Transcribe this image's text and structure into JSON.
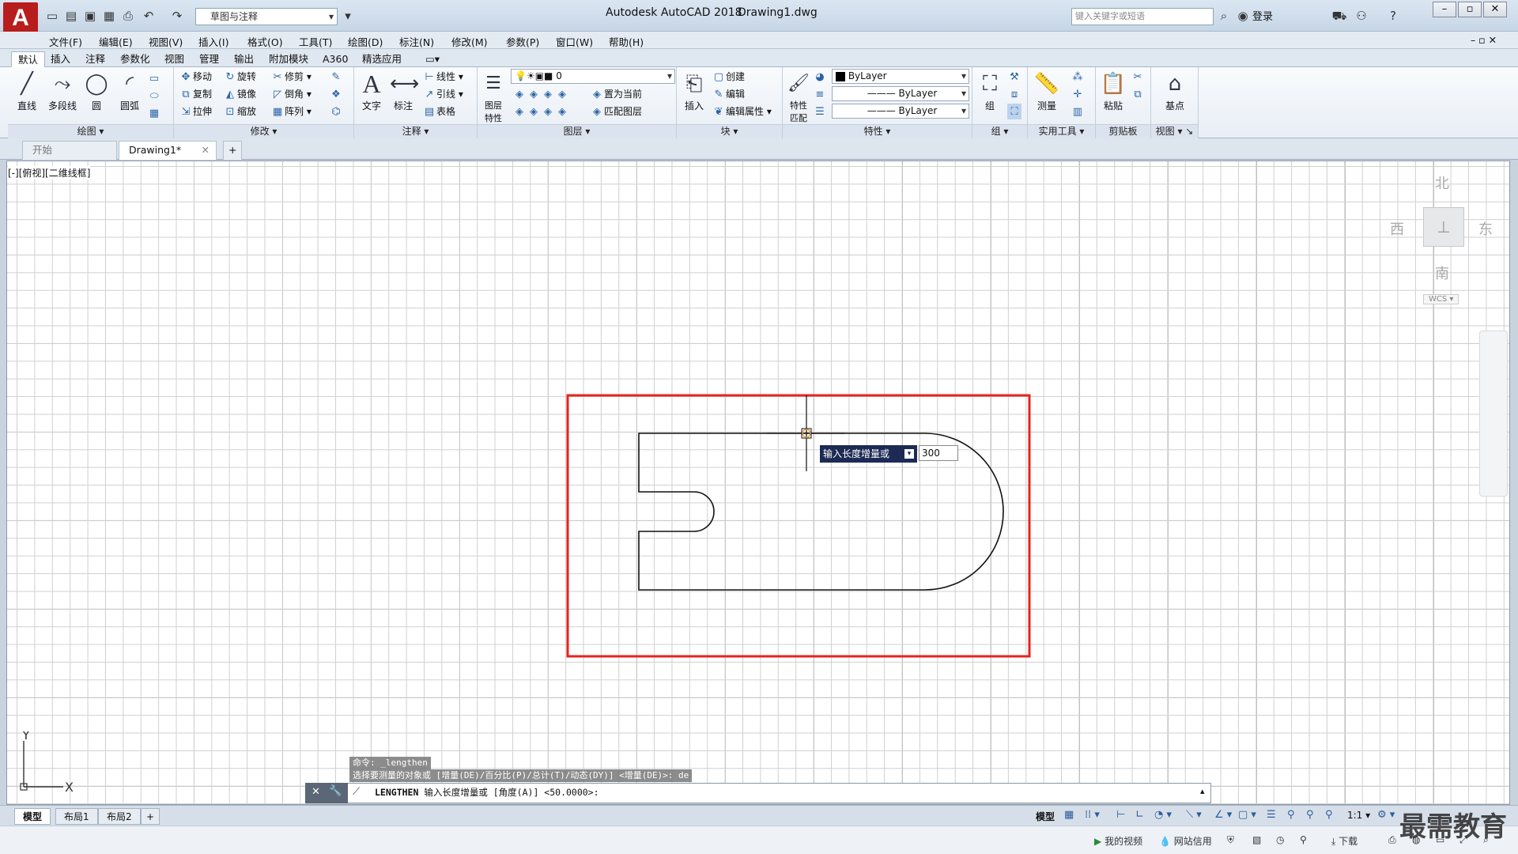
{
  "app": {
    "logo": "A",
    "title": "Autodesk AutoCAD 2018",
    "document": "Drawing1.dwg",
    "workspace": "草图与注释",
    "search_placeholder": "键入关键字或短语",
    "login": "登录"
  },
  "menus": [
    "文件(F)",
    "编辑(E)",
    "视图(V)",
    "插入(I)",
    "格式(O)",
    "工具(T)",
    "绘图(D)",
    "标注(N)",
    "修改(M)",
    "参数(P)",
    "窗口(W)",
    "帮助(H)"
  ],
  "ribbon_tabs": [
    "默认",
    "插入",
    "注释",
    "参数化",
    "视图",
    "管理",
    "输出",
    "附加模块",
    "A360",
    "精选应用"
  ],
  "ribbon": {
    "draw": {
      "label": "绘图",
      "line": "直线",
      "polyline": "多段线",
      "circle": "圆",
      "arc": "圆弧"
    },
    "modify": {
      "label": "修改",
      "move": "移动",
      "rotate": "旋转",
      "trim": "修剪",
      "copy": "复制",
      "mirror": "镜像",
      "fillet": "倒角",
      "stretch": "拉伸",
      "scale": "缩放",
      "array": "阵列"
    },
    "annotation": {
      "label": "注释",
      "text": "文字",
      "dim": "标注",
      "linear": "线性",
      "leader": "引线",
      "table": "表格"
    },
    "layers": {
      "label": "图层",
      "props": "图层\n特性",
      "current_layer": "0",
      "set_current": "置为当前",
      "match_layer": "匹配图层"
    },
    "block": {
      "label": "块",
      "insert": "插入",
      "create": "创建",
      "edit": "编辑",
      "edit_attr": "编辑属性"
    },
    "properties": {
      "label": "特性",
      "match": "特性\n匹配",
      "color": "ByLayer",
      "linetype": "ByLayer",
      "lineweight": "ByLayer"
    },
    "groups": {
      "label": "组",
      "group": "组"
    },
    "utilities": {
      "label": "实用工具",
      "measure": "测量"
    },
    "clipboard": {
      "label": "剪贴板",
      "paste": "粘贴"
    },
    "view": {
      "label": "视图",
      "base": "基点"
    }
  },
  "file_tabs": {
    "start": "开始",
    "drawing": "Drawing1*",
    "add": "+"
  },
  "viewport_label": "[-][俯视][二维线框]",
  "viewcube": {
    "north": "北",
    "south": "南",
    "east": "东",
    "west": "西",
    "wcs": "WCS"
  },
  "ucs": {
    "x": "X",
    "y": "Y"
  },
  "dynamic_input": {
    "prompt": "输入长度增量或",
    "value": "300"
  },
  "command": {
    "history": [
      "命令: _lengthen",
      "选择要测量的对象或 [增量(DE)/百分比(P)/总计(T)/动态(DY)] <增量(DE)>: de"
    ],
    "current_cmd": "LENGTHEN",
    "current_prompt": "输入长度增量或 [角度(A)] <50.0000>:"
  },
  "layout_tabs": [
    "模型",
    "布局1",
    "布局2"
  ],
  "status": {
    "model": "模型",
    "scale": "1:1"
  },
  "bottom_bar": [
    "我的视频",
    "网站信用",
    "下载"
  ],
  "watermark": "最需教育",
  "colors": {
    "highlight_rect": "#e8231e",
    "tooltip_bg": "#1c2a54",
    "logo_red": "#b81d1d"
  }
}
